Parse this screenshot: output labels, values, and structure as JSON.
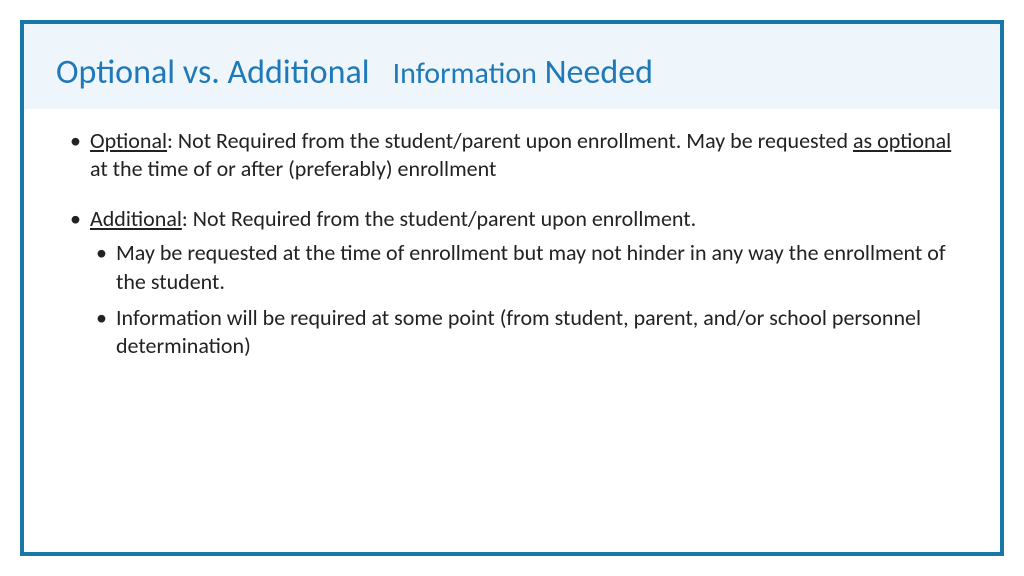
{
  "title": {
    "part1": "Optional vs. Additional",
    "part2": "Information",
    "part3": "Needed"
  },
  "bullets": {
    "opt_label": "Optional",
    "opt_text1": ": Not Required from the student/parent upon enrollment. May be requested ",
    "opt_underline": "as optional ",
    "opt_text2": "at the time of or after (preferably) enrollment",
    "add_label": "Additional",
    "add_text": ": Not Required from the student/parent upon enrollment.",
    "add_sub1": "May be requested at the time of enrollment but may not hinder in any way the enrollment of the student.",
    "add_sub2": "Information will be required at some point (from student, parent, and/or school personnel determination)"
  }
}
